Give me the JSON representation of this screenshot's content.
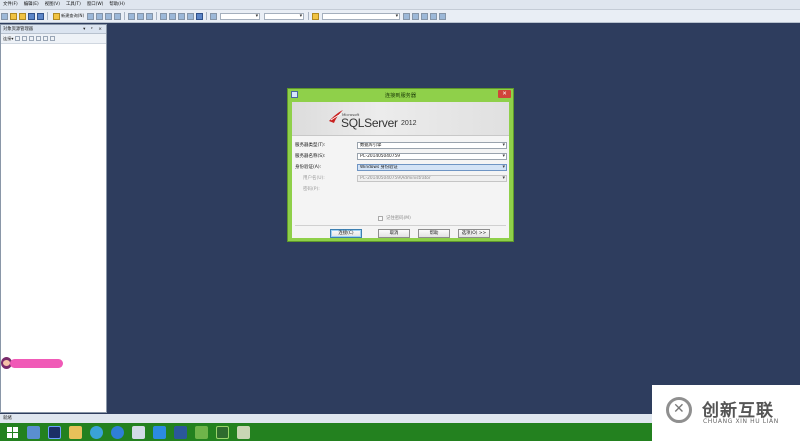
{
  "menu": [
    "文件(F)",
    "编辑(E)",
    "视图(V)",
    "工具(T)",
    "窗口(W)",
    "帮助(H)"
  ],
  "toolbar": {
    "new_query_label": "新建查询(N)"
  },
  "explorer": {
    "title": "对象资源管理器",
    "connect_label": "连接▾",
    "pin_icons": "▾ ᵖ ×"
  },
  "mascot_text": "",
  "status_text": "就绪",
  "dialog": {
    "title": "连接到服务器",
    "product": {
      "vendor": "Microsoft",
      "name": "SQLServer",
      "version": "2012"
    },
    "fields": [
      {
        "label": "服务器类型(T):",
        "value": "数据库引擎",
        "state": "normal"
      },
      {
        "label": "服务器名称(S):",
        "value": "PC-201405040759",
        "state": "normal"
      },
      {
        "label": "身份验证(A):",
        "value": "Windows 身份验证",
        "state": "selected"
      },
      {
        "label": "用户名(U):",
        "value": "PC-201405040759\\Administrator",
        "state": "disabled"
      },
      {
        "label": "密码(P):",
        "value": "",
        "state": "disabled-label"
      }
    ],
    "remember_label": "记住密码(M)",
    "buttons": {
      "connect": "连接(C)",
      "cancel": "取消",
      "help": "帮助",
      "options": "选项(O) >>"
    }
  },
  "watermark": {
    "cn": "创新互联",
    "en": "CHUANG XIN HU LIAN"
  }
}
